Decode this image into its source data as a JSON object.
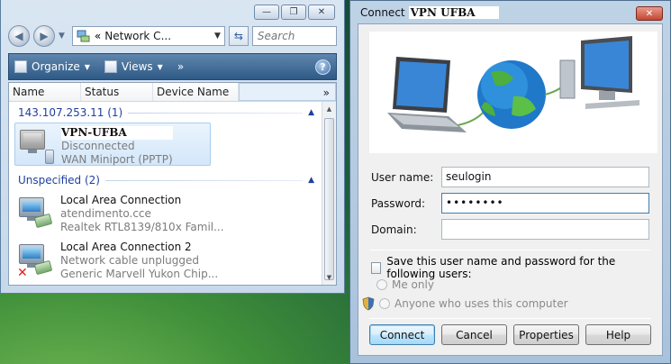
{
  "explorer": {
    "window_controls": [
      "—",
      "❐",
      "✕"
    ],
    "address": {
      "prefix": "«",
      "text": "Network C...",
      "dropdown": "▼"
    },
    "refresh_icon": "refresh-icon",
    "search": {
      "placeholder": "Search"
    },
    "toolbar": {
      "organize": "Organize",
      "views": "Views",
      "more": "»"
    },
    "columns": {
      "name": "Name",
      "status": "Status",
      "device": "Device Name",
      "more": "»"
    },
    "groups": [
      {
        "header": "143.107.253.11 (1)",
        "items": [
          {
            "name": "VPN-UFBA",
            "line2": "Disconnected",
            "line3": "WAN Miniport (PPTP)"
          }
        ]
      },
      {
        "header": "Unspecified (2)",
        "items": [
          {
            "name": "Local Area Connection",
            "line2": "atendimento.cce",
            "line3": "Realtek RTL8139/810x Famil..."
          },
          {
            "name": "Local Area Connection 2",
            "line2": "Network cable unplugged",
            "line3": "Generic Marvell Yukon Chip..."
          }
        ]
      }
    ]
  },
  "dialog": {
    "title_prefix": "Connect",
    "title_name": "VPN UFBA",
    "close": "✕",
    "fields": {
      "username_label": "User name:",
      "username_value": "seulogin",
      "password_label": "Password:",
      "password_value": "••••••••",
      "domain_label": "Domain:",
      "domain_value": ""
    },
    "save_checkbox": {
      "label": "Save this user name and password for the following users:",
      "checked": false
    },
    "radios": {
      "me_only": "Me only",
      "anyone": "Anyone who uses this computer"
    },
    "buttons": {
      "connect": "Connect",
      "cancel": "Cancel",
      "properties": "Properties",
      "help": "Help"
    }
  },
  "colors": {
    "accent": "#3c7fb1",
    "group_header": "#1f3f9f",
    "close_red": "#c44634"
  }
}
